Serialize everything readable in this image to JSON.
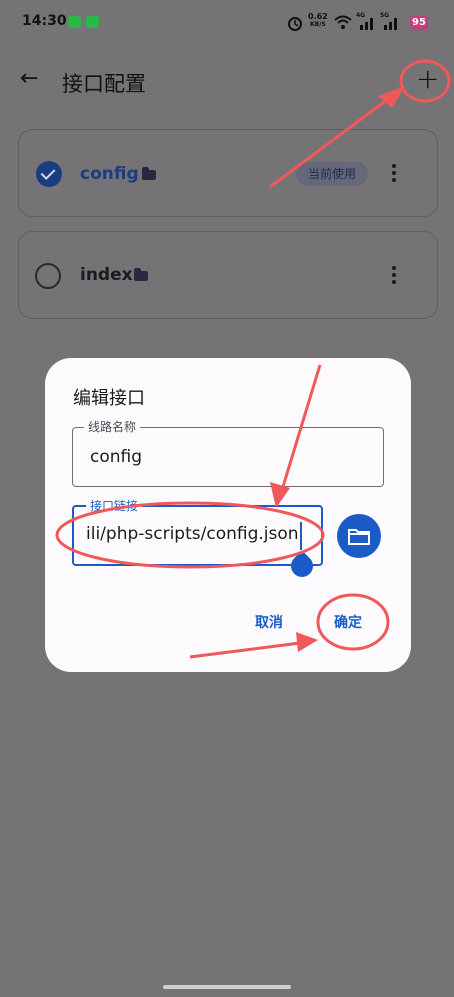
{
  "status_bar": {
    "time": "14:30",
    "net_speed": "0.62",
    "net_unit": "KB/S",
    "net_4g": "4G",
    "net_5g": "5G",
    "battery": "95"
  },
  "app_bar": {
    "title": "接口配置",
    "back_icon": "arrow-left-icon",
    "add_icon": "plus-icon"
  },
  "items": [
    {
      "name": "config",
      "selected": true,
      "badge": "当前使用"
    },
    {
      "name": "index",
      "selected": false
    }
  ],
  "dialog": {
    "title": "编辑接口",
    "name_label": "线路名称",
    "name_value": "config",
    "url_label": "接口链接",
    "url_value": "ili/php-scripts/config.json",
    "cancel": "取消",
    "confirm": "确定"
  },
  "colors": {
    "accent": "#1a5bc8",
    "annotation": "#f0595a",
    "scrim": "#757375"
  }
}
